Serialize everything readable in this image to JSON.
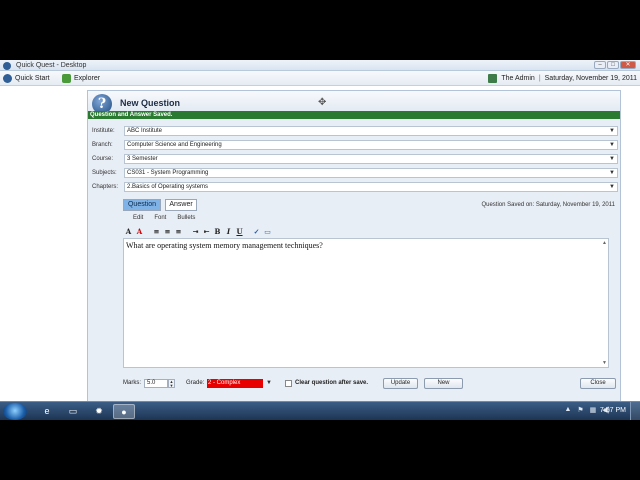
{
  "window": {
    "title": "Quick Quest - Desktop"
  },
  "toolbar": {
    "quick_start": "Quick Start",
    "explorer": "Explorer",
    "user": "The Admin",
    "separator": "|",
    "date": "Saturday, November 19, 2011"
  },
  "panel": {
    "logo_glyph": "?",
    "title": "New Question",
    "saved_banner": "Question and Answer Saved."
  },
  "form": {
    "institute_label": "Institute:",
    "institute_value": "ABC Institute",
    "branch_label": "Branch:",
    "branch_value": "Computer Science and Engineering",
    "course_label": "Course:",
    "course_value": "3 Semester",
    "subjects_label": "Subjects:",
    "subjects_value": "CS031 - System Programming",
    "chapters_label": "Chapters:",
    "chapters_value": "2.Basics of Operating systems"
  },
  "tabs": {
    "question": "Question",
    "answer": "Answer"
  },
  "saved_on": "Question Saved on: Saturday, November 19, 2011",
  "sub_menu": {
    "edit": "Edit",
    "font": "Font",
    "bullets": "Bullets"
  },
  "editor": {
    "text": "What are operating system memory management techniques?"
  },
  "bottom": {
    "marks_label": "Marks:",
    "marks_value": "5.0",
    "grade_label": "Grade:",
    "grade_value": "2 - Complex",
    "clear_label": "Clear question after save.",
    "update": "Update",
    "new": "New",
    "close": "Close"
  },
  "taskbar": {
    "clock": "7:57 PM"
  },
  "colors": {
    "banner": "#2a7a32",
    "grade": "#e80000",
    "tab_active": "#7fb3e8"
  }
}
